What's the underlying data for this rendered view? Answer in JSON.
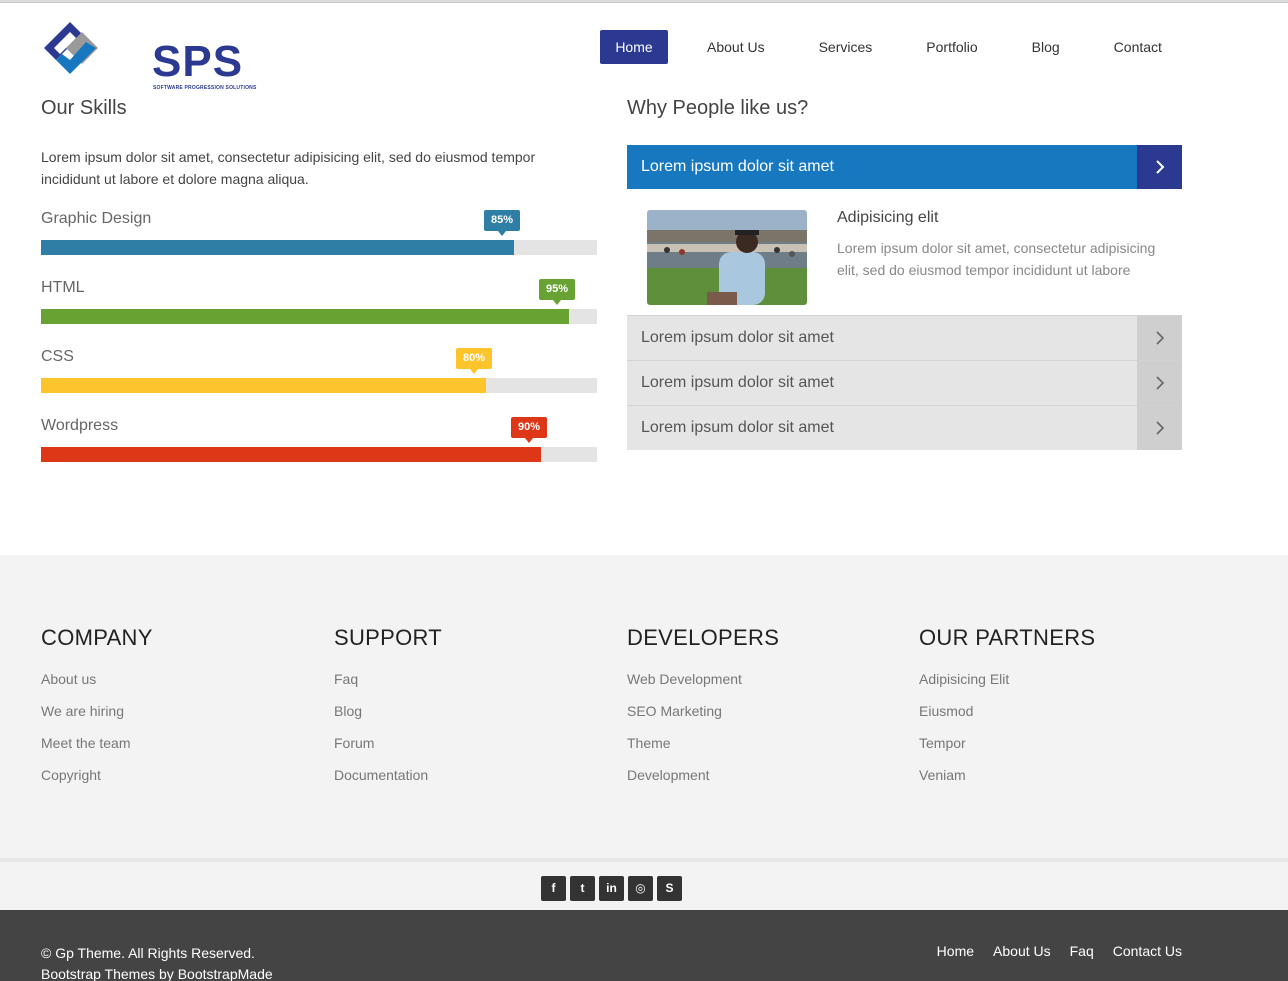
{
  "brand": {
    "name": "SPS",
    "tagline": "SOFTWARE PROGRESSION SOLUTIONS",
    "colors": {
      "primary": "#2b3990",
      "accent": "#1778c0"
    }
  },
  "nav": {
    "items": [
      {
        "label": "Home",
        "active": true
      },
      {
        "label": "About Us"
      },
      {
        "label": "Services"
      },
      {
        "label": "Portfolio"
      },
      {
        "label": "Blog"
      },
      {
        "label": "Contact"
      }
    ]
  },
  "skills": {
    "title": "Our Skills",
    "intro": "Lorem ipsum dolor sit amet, consectetur adipisicing elit, sed do eiusmod tempor incididunt ut labore et dolore magna aliqua.",
    "items": [
      {
        "name": "Graphic Design",
        "percent": 85,
        "label": "85%",
        "color": "#2e7ea6"
      },
      {
        "name": "HTML",
        "percent": 95,
        "label": "95%",
        "color": "#67a232"
      },
      {
        "name": "CSS",
        "percent": 80,
        "label": "80%",
        "color": "#fdc42c"
      },
      {
        "name": "Wordpress",
        "percent": 90,
        "label": "90%",
        "color": "#dd3718"
      }
    ]
  },
  "why": {
    "title": "Why People like us?",
    "active": {
      "label": "Lorem ipsum dolor sit amet",
      "heading": "Adipisicing elit",
      "text": "Lorem ipsum dolor sit amet, consectetur adipisicing elit, sed do eiusmod tempor incididunt ut labore",
      "icon": "chevron-right-icon"
    },
    "items": [
      {
        "label": "Lorem ipsum dolor sit amet"
      },
      {
        "label": "Lorem ipsum dolor sit amet"
      },
      {
        "label": "Lorem ipsum dolor sit amet"
      }
    ]
  },
  "footer": {
    "columns": [
      {
        "title": "COMPANY",
        "links": [
          "About us",
          "We are hiring",
          "Meet the team",
          "Copyright"
        ]
      },
      {
        "title": "SUPPORT",
        "links": [
          "Faq",
          "Blog",
          "Forum",
          "Documentation"
        ]
      },
      {
        "title": "DEVELOPERS",
        "links": [
          "Web Development",
          "SEO Marketing",
          "Theme",
          "Development"
        ]
      },
      {
        "title": "OUR PARTNERS",
        "links": [
          "Adipisicing Elit",
          "Eiusmod",
          "Tempor",
          "Veniam"
        ]
      }
    ],
    "social": [
      {
        "icon": "facebook-icon",
        "glyph": "f"
      },
      {
        "icon": "twitter-icon",
        "glyph": "t"
      },
      {
        "icon": "linkedin-icon",
        "glyph": "in"
      },
      {
        "icon": "dribbble-icon",
        "glyph": "◎"
      },
      {
        "icon": "skype-icon",
        "glyph": "S"
      }
    ],
    "copyright": "© Gp Theme. All Rights Reserved.",
    "credit": "Bootstrap Themes by BootstrapMade",
    "bottom_links": [
      "Home",
      "About Us",
      "Faq",
      "Contact Us"
    ]
  }
}
